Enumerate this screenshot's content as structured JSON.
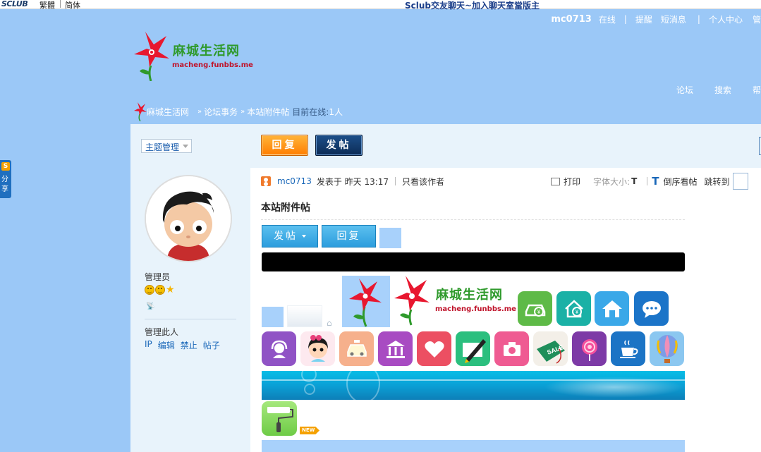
{
  "topbar": {
    "brand": "SCLUB",
    "lang_traditional": "繁體",
    "lang_simplified": "简体",
    "center_title": "Sclub交友聊天~加入聊天室當版主"
  },
  "header": {
    "username": "mc0713",
    "status": "在线",
    "links": [
      "提醒",
      "短消息",
      "个人中心",
      "管"
    ],
    "site_name": "麻城生活网",
    "site_url": "macheng.funbbs.me",
    "nav": [
      "论坛",
      "搜索",
      "帮"
    ]
  },
  "breadcrumb": {
    "home": "麻城生活网",
    "items": [
      "论坛事务",
      "本站附件帖"
    ],
    "online_label": "目前在线:",
    "online_count": "1人"
  },
  "sidebar": {
    "topic_manage": "主题管理",
    "role": "管理员",
    "manage_label": "管理此人",
    "manage_links": [
      "IP",
      "编辑",
      "禁止",
      "帖子"
    ]
  },
  "toolbar": {
    "reply": "回复",
    "post": "发帖"
  },
  "post": {
    "author": "mc0713",
    "posted": "发表于 昨天 13:17",
    "only_author": "只看该作者",
    "print": "打印",
    "font_size_label": "字体大小:",
    "font_size_t": "T",
    "reverse_icon": "T",
    "reverse": "倒序看帖",
    "jump": "跳转到",
    "title": "本站附件帖",
    "btn_post": "发帖",
    "btn_reply": "回复",
    "new_tag": "NEW"
  },
  "share": {
    "logo": "S",
    "label": "分享"
  },
  "colors": {
    "background": "#9bc8f7",
    "accent_orange": "#ff7e00",
    "link_blue": "#1a68b9",
    "brand_green": "#2f9a2c",
    "brand_red": "#c0142b"
  }
}
